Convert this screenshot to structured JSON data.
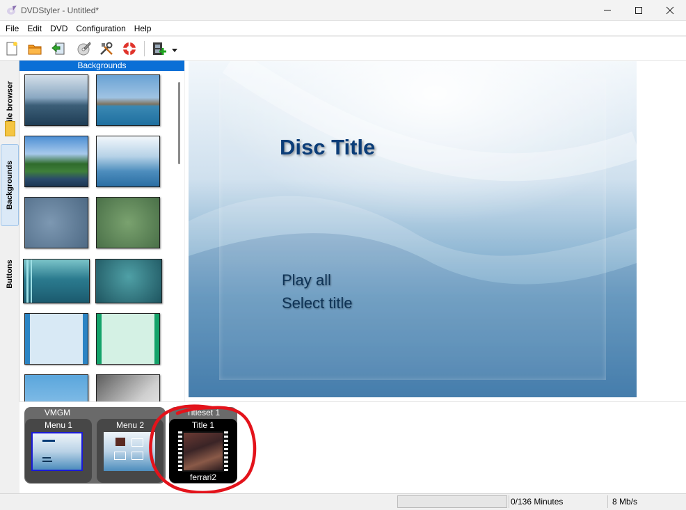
{
  "window": {
    "title": "DVDStyler - Untitled*"
  },
  "menubar": {
    "items": [
      "File",
      "Edit",
      "DVD",
      "Configuration",
      "Help"
    ]
  },
  "sidebar": {
    "tabs": [
      "File browser",
      "Backgrounds",
      "Buttons"
    ],
    "active_tab": "Backgrounds",
    "panel_title": "Backgrounds"
  },
  "canvas": {
    "title": "Disc Title",
    "buttons": [
      "Play all",
      "Select title"
    ]
  },
  "titleset_bar": {
    "vmgm": {
      "label": "VMGM",
      "menus": [
        "Menu 1",
        "Menu 2"
      ]
    },
    "titleset": {
      "label": "Titleset 1",
      "title": "Title 1",
      "file": "ferrari2"
    }
  },
  "status": {
    "duration": "0/136 Minutes",
    "bitrate": "8 Mb/s",
    "progress": 0
  },
  "colors": {
    "accent": "#0a6fd6",
    "annotation": "#e3131b",
    "disc_title": "#0b3d78"
  }
}
